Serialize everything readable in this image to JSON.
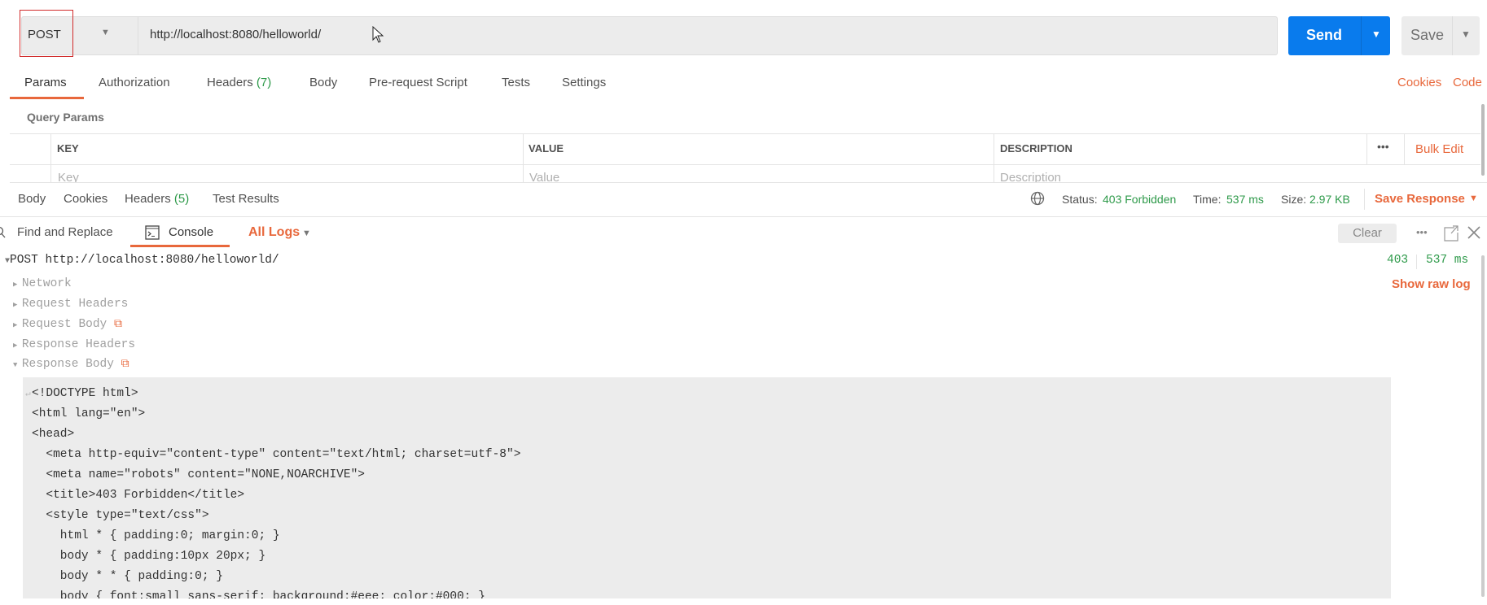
{
  "request": {
    "method": "POST",
    "url": "http://localhost:8080/helloworld/",
    "send_label": "Send",
    "save_label": "Save"
  },
  "req_tabs": [
    {
      "label": "Params"
    },
    {
      "label": "Authorization"
    },
    {
      "label": "Headers",
      "count": "(7)"
    },
    {
      "label": "Body"
    },
    {
      "label": "Pre-request Script"
    },
    {
      "label": "Tests"
    },
    {
      "label": "Settings"
    }
  ],
  "req_links": {
    "cookies": "Cookies",
    "code": "Code"
  },
  "query_params": {
    "title": "Query Params",
    "headers": [
      "KEY",
      "VALUE",
      "DESCRIPTION"
    ],
    "bulk_edit": "Bulk Edit",
    "placeholders": [
      "Key",
      "Value",
      "Description"
    ]
  },
  "resp_tabs": [
    {
      "label": "Body"
    },
    {
      "label": "Cookies"
    },
    {
      "label": "Headers",
      "count": "(5)"
    },
    {
      "label": "Test Results"
    }
  ],
  "status": {
    "status_label": "Status:",
    "status_value": "403 Forbidden",
    "time_label": "Time:",
    "time_value": "537 ms",
    "size_label": "Size:",
    "size_value": "2.97 KB",
    "save_response": "Save Response"
  },
  "console": {
    "find_replace": "Find and Replace",
    "console_tab": "Console",
    "all_logs": "All Logs",
    "clear": "Clear",
    "entry": {
      "title": "POST http://localhost:8080/helloworld/",
      "code": "403",
      "time": "537 ms",
      "show_raw": "Show raw log"
    },
    "sections": [
      "Network",
      "Request Headers",
      "Request Body",
      "Response Headers",
      "Response Body"
    ],
    "body_lines": [
      "<!DOCTYPE html>",
      "<html lang=\"en\">",
      "<head>",
      "  <meta http-equiv=\"content-type\" content=\"text/html; charset=utf-8\">",
      "  <meta name=\"robots\" content=\"NONE,NOARCHIVE\">",
      "  <title>403 Forbidden</title>",
      "  <style type=\"text/css\">",
      "    html * { padding:0; margin:0; }",
      "    body * { padding:10px 20px; }",
      "    body * * { padding:0; }",
      "    body { font:small sans-serif; background:#eee; color:#000; }"
    ]
  },
  "colors": {
    "accent": "#e8683c",
    "send": "#097bed",
    "success": "#2e9a4a"
  }
}
